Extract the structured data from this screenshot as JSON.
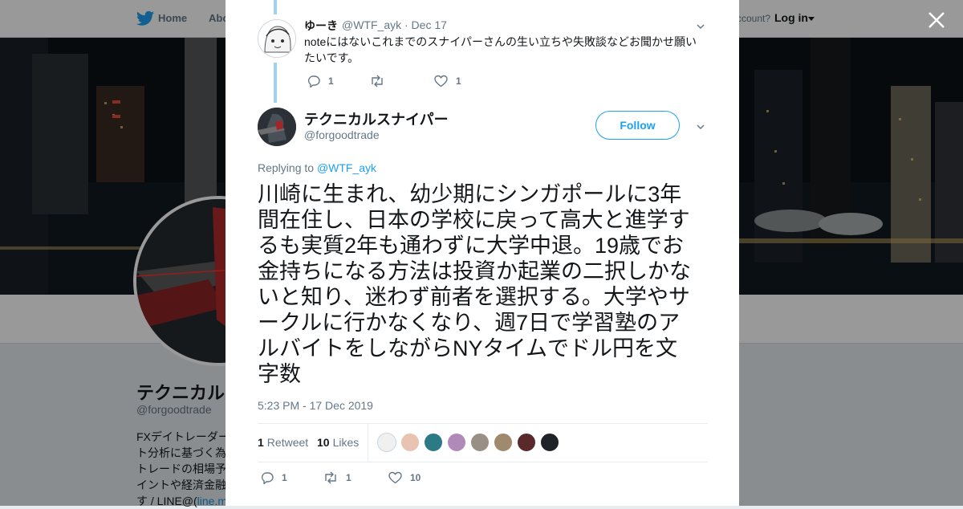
{
  "topbar": {
    "home_label": "Home",
    "about_label": "Abo",
    "account_question": "ccount?",
    "login_label": "Log in"
  },
  "profile": {
    "name": "テクニカル",
    "handle": "@forgoodtrade",
    "bio_lines": [
      "FXデイトレーダー",
      "ト分析に基づく為",
      "トレードの相場予",
      "イントや経済金融",
      "す / LINE@("
    ],
    "bio_link": "line.m"
  },
  "reply_tweet": {
    "name": "ゆーき",
    "handle": "@WTF_ayk · Dec 17",
    "text_lines": [
      "noteにはないこれまでのスナイパーさんの生い立ちや失敗談などお聞かせ願い",
      "たいです。"
    ],
    "reply_count": "1",
    "retweet_count": "",
    "like_count": "1"
  },
  "main_tweet": {
    "name": "テクニカルスナイパー",
    "handle": "@forgoodtrade",
    "follow_label": "Follow",
    "replying_prefix": "Replying to",
    "replying_to": "@WTF_ayk",
    "text_lines": [
      "川崎に生まれ、幼少期にシンガポールに3年",
      "間在住し、日本の学校に戻って高大と進学す",
      "るも実質2年も通わずに大学中退。19歳でお",
      "金持ちになる方法は投資か起業の二択しかな",
      "いと知り、迷わず前者を選択する。大学やサ",
      "ークルに行かなくなり、週7日で学習塾のア",
      "ルバイトをしながらNYタイムでドル円を文",
      "字数"
    ],
    "timestamp": "5:23 PM - 17 Dec 2019",
    "retweets_num": "1",
    "retweets_label": "Retweet",
    "likes_num": "10",
    "likes_label": "Likes",
    "reply_count": "1",
    "retweet_count": "1",
    "like_count": "10"
  },
  "colors": {
    "accent": "#1da1f2",
    "thread_line": "#9fd1f2",
    "text": "#14171a",
    "muted": "#657786"
  }
}
